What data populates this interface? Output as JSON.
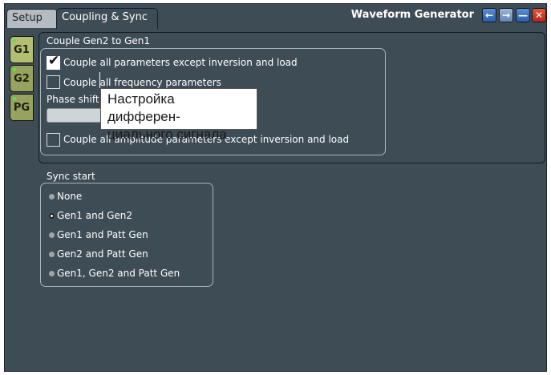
{
  "tabs": [
    "Setup",
    "Coupling & Sync"
  ],
  "window": {
    "title": "Waveform Generator",
    "buttons": [
      "left-arrow-icon",
      "right-arrow-icon",
      "minimize-icon",
      "close-icon"
    ]
  },
  "side_tabs": [
    "G1",
    "G2",
    "PG"
  ],
  "couple": {
    "heading": "Couple Gen2 to Gen1",
    "all_params_label": "Couple all parameters except inversion and load",
    "all_params_checked": true,
    "frequency_label": "Couple all frequency parameters",
    "frequency_checked": false,
    "phase_label": "Phase shift",
    "phase_value": "",
    "amplitude_label": "Couple all amplitude parameters except inversion and load",
    "amplitude_checked": false
  },
  "sync": {
    "heading": "Sync start",
    "options": [
      "None",
      "Gen1 and Gen2",
      "Gen1 and Patt Gen",
      "Gen2 and Patt Gen",
      "Gen1, Gen2 and Patt Gen"
    ],
    "selected": "Gen1 and Gen2"
  },
  "callout": {
    "line1": "Настройка дифферен-",
    "line2": "циального сигнала"
  }
}
